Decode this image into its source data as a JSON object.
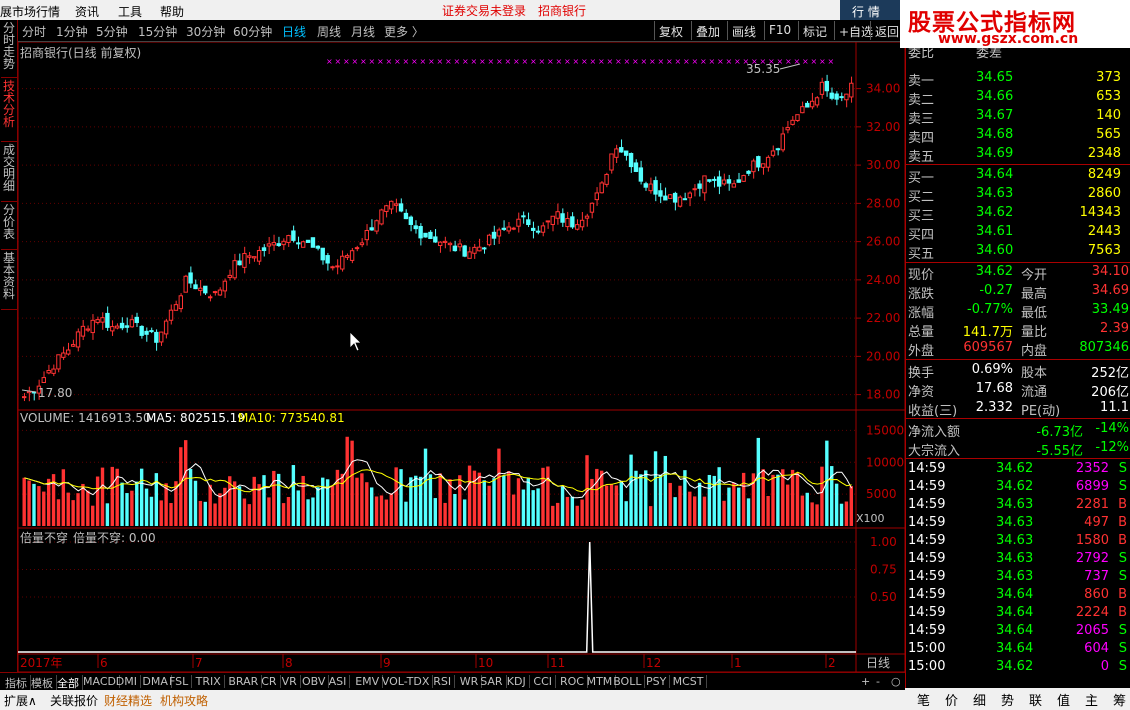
{
  "menubar": {
    "items": [
      "展市场行情",
      "资讯",
      "工具",
      "帮助"
    ],
    "alert1": "证券交易未登录",
    "alert2": "招商银行"
  },
  "top_tabs": {
    "quote": "行 情"
  },
  "logo": {
    "title": "股票公式指标网",
    "url": "www.gszx.com.cn"
  },
  "periods": {
    "items": [
      "分时",
      "1分钟",
      "5分钟",
      "15分钟",
      "30分钟",
      "60分钟",
      "日线",
      "周线",
      "月线",
      "更多 〉"
    ],
    "active": "日线"
  },
  "toolbar": {
    "fuquan": "复权",
    "diejia": "叠加",
    "huaxian": "画线",
    "f10": "F10",
    "biaoji": "标记",
    "zixuan": "+自选",
    "fanhui": "返回"
  },
  "left_tabs": [
    "分时走势",
    "技术分析",
    "成交明细",
    "分价表",
    "基本资料"
  ],
  "chart": {
    "title": "招商银行(日线 前复权)",
    "high_label": "35.35",
    "low_label": "17.80",
    "price_ticks": [
      "34.00",
      "32.00",
      "30.00",
      "28.00",
      "26.00",
      "24.00",
      "22.00",
      "20.00",
      "18.00"
    ],
    "volume_header": {
      "vol": "VOLUME: 1416913.50",
      "ma5": "MA5: 802515.19",
      "ma10": "MA10: 773540.81"
    },
    "volume_ticks": [
      "15000",
      "10000",
      "5000"
    ],
    "volume_unit": "X100",
    "indicator_header": {
      "name": "倍量不穿",
      "value": "倍量不穿: 0.00"
    },
    "indicator_ticks": [
      "1.00",
      "0.75",
      "0.50"
    ],
    "x_labels": [
      "2017年",
      "6",
      "7",
      "8",
      "9",
      "10",
      "11",
      "12",
      "1",
      "2"
    ],
    "period_label": "日线",
    "colors": {
      "up": "#ff3232",
      "down": "#54ffff",
      "ma5": "#ffffff",
      "ma10": "#ffff00",
      "axis": "#a00000"
    }
  },
  "chart_data": {
    "type": "candlestick",
    "title": "招商银行(日线 前复权)",
    "close_trend": [
      17.9,
      18.6,
      19.6,
      20.4,
      21.5,
      22.1,
      21.5,
      21.8,
      21.3,
      20.9,
      22.4,
      24.0,
      23.5,
      23.2,
      24.6,
      25.2,
      25.5,
      25.9,
      26.4,
      26.0,
      25.3,
      24.6,
      25.4,
      26.2,
      27.4,
      27.9,
      26.9,
      26.4,
      26.1,
      25.7,
      25.5,
      25.8,
      26.3,
      26.9,
      27.1,
      26.6,
      27.4,
      26.9,
      27.5,
      28.6,
      31.2,
      30.3,
      29.0,
      28.6,
      28.3,
      28.5,
      29.3,
      29.0,
      28.9,
      29.8,
      30.3,
      31.1,
      32.4,
      33.0,
      34.1,
      33.2,
      34.0
    ],
    "price_ylim": [
      17.3,
      35.6
    ],
    "volume_ylim": [
      0,
      16000
    ],
    "indicator_spike": {
      "x_label": "11",
      "value": 1.0
    }
  },
  "right_panel": {
    "header": {
      "left": "委比",
      "right": "委差"
    },
    "sell": [
      {
        "label": "卖五",
        "price": "34.69",
        "vol": "2348"
      },
      {
        "label": "卖四",
        "price": "34.68",
        "vol": "565"
      },
      {
        "label": "卖三",
        "price": "34.67",
        "vol": "140"
      },
      {
        "label": "卖二",
        "price": "34.66",
        "vol": "653"
      },
      {
        "label": "卖一",
        "price": "34.65",
        "vol": "373"
      }
    ],
    "buy": [
      {
        "label": "买一",
        "price": "34.64",
        "vol": "8249"
      },
      {
        "label": "买二",
        "price": "34.63",
        "vol": "2860"
      },
      {
        "label": "买三",
        "price": "34.62",
        "vol": "14343"
      },
      {
        "label": "买四",
        "price": "34.61",
        "vol": "2443"
      },
      {
        "label": "买五",
        "price": "34.60",
        "vol": "7563"
      }
    ],
    "stats": [
      {
        "l1": "现价",
        "v1": "34.62",
        "l2": "今开",
        "v2": "34.10"
      },
      {
        "l1": "涨跌",
        "v1": "-0.27",
        "l2": "最高",
        "v2": "34.69"
      },
      {
        "l1": "涨幅",
        "v1": "-0.77%",
        "l2": "最低",
        "v2": "33.49"
      },
      {
        "l1": "总量",
        "v1": "141.7万",
        "l2": "量比",
        "v2": "2.39"
      },
      {
        "l1": "外盘",
        "v1": "609567",
        "l2": "内盘",
        "v2": "807346"
      }
    ],
    "stats2": [
      {
        "l1": "换手",
        "v1": "0.69%",
        "l2": "股本",
        "v2": "252亿"
      },
      {
        "l1": "净资",
        "v1": "17.68",
        "l2": "流通",
        "v2": "206亿"
      },
      {
        "l1": "收益(三)",
        "v1": "2.332",
        "l2": "PE(动)",
        "v2": "11.1"
      }
    ],
    "flows": [
      {
        "label": "净流入额",
        "v1": "-6.73亿",
        "v2": "-14%"
      },
      {
        "label": "大宗流入",
        "v1": "-5.55亿",
        "v2": "-12%"
      }
    ],
    "ticks": [
      {
        "t": "14:59",
        "p": "34.62",
        "v": "2352",
        "s": "S"
      },
      {
        "t": "14:59",
        "p": "34.62",
        "v": "6899",
        "s": "S"
      },
      {
        "t": "14:59",
        "p": "34.63",
        "v": "2281",
        "s": "B"
      },
      {
        "t": "14:59",
        "p": "34.63",
        "v": "497",
        "s": "B"
      },
      {
        "t": "14:59",
        "p": "34.63",
        "v": "1580",
        "s": "B"
      },
      {
        "t": "14:59",
        "p": "34.63",
        "v": "2792",
        "s": "S"
      },
      {
        "t": "14:59",
        "p": "34.63",
        "v": "737",
        "s": "S"
      },
      {
        "t": "14:59",
        "p": "34.64",
        "v": "860",
        "s": "B"
      },
      {
        "t": "14:59",
        "p": "34.64",
        "v": "2224",
        "s": "B"
      },
      {
        "t": "14:59",
        "p": "34.64",
        "v": "2065",
        "s": "S"
      },
      {
        "t": "15:00",
        "p": "34.64",
        "v": "604",
        "s": "S"
      },
      {
        "t": "15:00",
        "p": "34.62",
        "v": "0",
        "s": "S"
      }
    ],
    "bottom_tabs": [
      "笔",
      "价",
      "细",
      "势",
      "联",
      "值",
      "主",
      "筹"
    ]
  },
  "indicator_tabs": {
    "items": [
      "指标",
      "模板",
      "全部",
      "MACD",
      "DMI",
      "DMA",
      "FSL",
      "TRIX",
      "BRAR",
      "CR",
      "VR",
      "OBV",
      "ASI",
      "EMV",
      "VOL-TDX",
      "RSI",
      "WR",
      "SAR",
      "KDJ",
      "CCI",
      "ROC",
      "MTM",
      "BOLL",
      "PSY",
      "MCST"
    ],
    "nav": [
      "+",
      "-",
      "○"
    ]
  },
  "bottom_bar": {
    "items": [
      "扩展∧",
      "关联报价",
      "财经精选",
      "机构攻略"
    ]
  }
}
